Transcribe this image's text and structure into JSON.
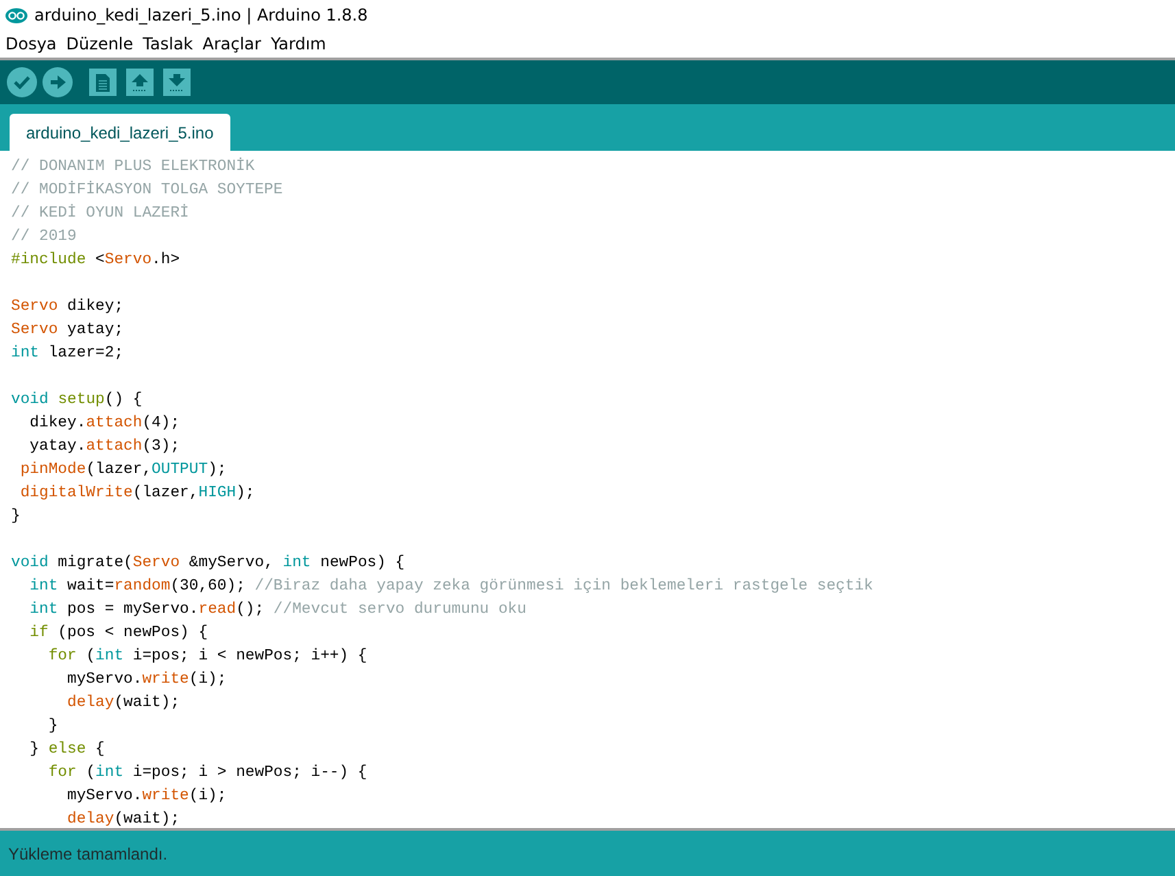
{
  "window": {
    "title": "arduino_kedi_lazeri_5.ino | Arduino 1.8.8"
  },
  "menu": [
    "Dosya",
    "Düzenle",
    "Taslak",
    "Araçlar",
    "Yardım"
  ],
  "toolbar": [
    {
      "kind": "verify"
    },
    {
      "kind": "upload"
    },
    {
      "kind": "new"
    },
    {
      "kind": "open"
    },
    {
      "kind": "save"
    }
  ],
  "tabs": [
    {
      "label": "arduino_kedi_lazeri_5.ino",
      "selected": true
    }
  ],
  "editor": {
    "lines": [
      {
        "kind": "code",
        "tokens": [
          {
            "kind": "comment",
            "text": "// DONANIM PLUS ELEKTRONİK"
          }
        ]
      },
      {
        "kind": "code",
        "tokens": [
          {
            "kind": "comment",
            "text": "// MODİFİKASYON TOLGA SOYTEPE"
          }
        ]
      },
      {
        "kind": "code",
        "tokens": [
          {
            "kind": "comment",
            "text": "// KEDİ OYUN LAZERİ"
          }
        ]
      },
      {
        "kind": "code",
        "tokens": [
          {
            "kind": "comment",
            "text": "// 2019"
          }
        ]
      },
      {
        "kind": "code",
        "tokens": [
          {
            "kind": "control",
            "text": "#include"
          },
          {
            "kind": "plain",
            "text": " <"
          },
          {
            "kind": "function",
            "text": "Servo"
          },
          {
            "kind": "plain",
            "text": ".h>"
          }
        ]
      },
      {
        "kind": "blank"
      },
      {
        "kind": "code",
        "tokens": [
          {
            "kind": "function",
            "text": "Servo"
          },
          {
            "kind": "plain",
            "text": " dikey;"
          }
        ]
      },
      {
        "kind": "code",
        "tokens": [
          {
            "kind": "function",
            "text": "Servo"
          },
          {
            "kind": "plain",
            "text": " yatay;"
          }
        ]
      },
      {
        "kind": "code",
        "tokens": [
          {
            "kind": "keyword",
            "text": "int"
          },
          {
            "kind": "plain",
            "text": " lazer=2;"
          }
        ]
      },
      {
        "kind": "blank"
      },
      {
        "kind": "code",
        "tokens": [
          {
            "kind": "keyword",
            "text": "void "
          },
          {
            "kind": "control",
            "text": "setup"
          },
          {
            "kind": "plain",
            "text": "() {"
          }
        ]
      },
      {
        "kind": "code",
        "tokens": [
          {
            "kind": "plain",
            "text": "  dikey."
          },
          {
            "kind": "function",
            "text": "attach"
          },
          {
            "kind": "plain",
            "text": "(4);"
          }
        ]
      },
      {
        "kind": "code",
        "tokens": [
          {
            "kind": "plain",
            "text": "  yatay."
          },
          {
            "kind": "function",
            "text": "attach"
          },
          {
            "kind": "plain",
            "text": "(3);"
          }
        ]
      },
      {
        "kind": "code",
        "tokens": [
          {
            "kind": "function",
            "text": " pinMode"
          },
          {
            "kind": "plain",
            "text": "(lazer,"
          },
          {
            "kind": "keyword",
            "text": "OUTPUT"
          },
          {
            "kind": "plain",
            "text": ");"
          }
        ]
      },
      {
        "kind": "code",
        "tokens": [
          {
            "kind": "function",
            "text": " digitalWrite"
          },
          {
            "kind": "plain",
            "text": "(lazer,"
          },
          {
            "kind": "keyword",
            "text": "HIGH"
          },
          {
            "kind": "plain",
            "text": ");"
          }
        ]
      },
      {
        "kind": "code",
        "tokens": [
          {
            "kind": "plain",
            "text": "}"
          }
        ]
      },
      {
        "kind": "blank"
      },
      {
        "kind": "code",
        "tokens": [
          {
            "kind": "keyword",
            "text": "void"
          },
          {
            "kind": "plain",
            "text": " migrate("
          },
          {
            "kind": "function",
            "text": "Servo"
          },
          {
            "kind": "plain",
            "text": " &myServo, "
          },
          {
            "kind": "keyword",
            "text": "int"
          },
          {
            "kind": "plain",
            "text": " newPos) {"
          }
        ]
      },
      {
        "kind": "code",
        "tokens": [
          {
            "kind": "keyword",
            "text": "  int"
          },
          {
            "kind": "plain",
            "text": " wait="
          },
          {
            "kind": "function",
            "text": "random"
          },
          {
            "kind": "plain",
            "text": "(30,60); "
          },
          {
            "kind": "comment",
            "text": "//Biraz daha yapay zeka görünmesi için beklemeleri rastgele seçtik"
          }
        ]
      },
      {
        "kind": "code",
        "tokens": [
          {
            "kind": "keyword",
            "text": "  int"
          },
          {
            "kind": "plain",
            "text": " pos = myServo."
          },
          {
            "kind": "function",
            "text": "read"
          },
          {
            "kind": "plain",
            "text": "(); "
          },
          {
            "kind": "comment",
            "text": "//Mevcut servo durumunu oku"
          }
        ]
      },
      {
        "kind": "code",
        "tokens": [
          {
            "kind": "control",
            "text": "  if"
          },
          {
            "kind": "plain",
            "text": " (pos < newPos) {"
          }
        ]
      },
      {
        "kind": "code",
        "tokens": [
          {
            "kind": "control",
            "text": "    for"
          },
          {
            "kind": "plain",
            "text": " ("
          },
          {
            "kind": "keyword",
            "text": "int"
          },
          {
            "kind": "plain",
            "text": " i=pos; i < newPos; i++) {"
          }
        ]
      },
      {
        "kind": "code",
        "tokens": [
          {
            "kind": "plain",
            "text": "      myServo."
          },
          {
            "kind": "function",
            "text": "write"
          },
          {
            "kind": "plain",
            "text": "(i);"
          }
        ]
      },
      {
        "kind": "code",
        "tokens": [
          {
            "kind": "function",
            "text": "      delay"
          },
          {
            "kind": "plain",
            "text": "(wait);"
          }
        ]
      },
      {
        "kind": "code",
        "tokens": [
          {
            "kind": "plain",
            "text": "    }"
          }
        ]
      },
      {
        "kind": "code",
        "tokens": [
          {
            "kind": "plain",
            "text": "  } "
          },
          {
            "kind": "control",
            "text": "else"
          },
          {
            "kind": "plain",
            "text": " {"
          }
        ]
      },
      {
        "kind": "code",
        "tokens": [
          {
            "kind": "control",
            "text": "    for"
          },
          {
            "kind": "plain",
            "text": " ("
          },
          {
            "kind": "keyword",
            "text": "int"
          },
          {
            "kind": "plain",
            "text": " i=pos; i > newPos; i--) {"
          }
        ]
      },
      {
        "kind": "code",
        "tokens": [
          {
            "kind": "plain",
            "text": "      myServo."
          },
          {
            "kind": "function",
            "text": "write"
          },
          {
            "kind": "plain",
            "text": "(i);"
          }
        ]
      },
      {
        "kind": "code",
        "tokens": [
          {
            "kind": "function",
            "text": "      delay"
          },
          {
            "kind": "plain",
            "text": "(wait);"
          }
        ]
      }
    ]
  },
  "status_bar": {
    "message": "Yükleme tamamlandı."
  }
}
